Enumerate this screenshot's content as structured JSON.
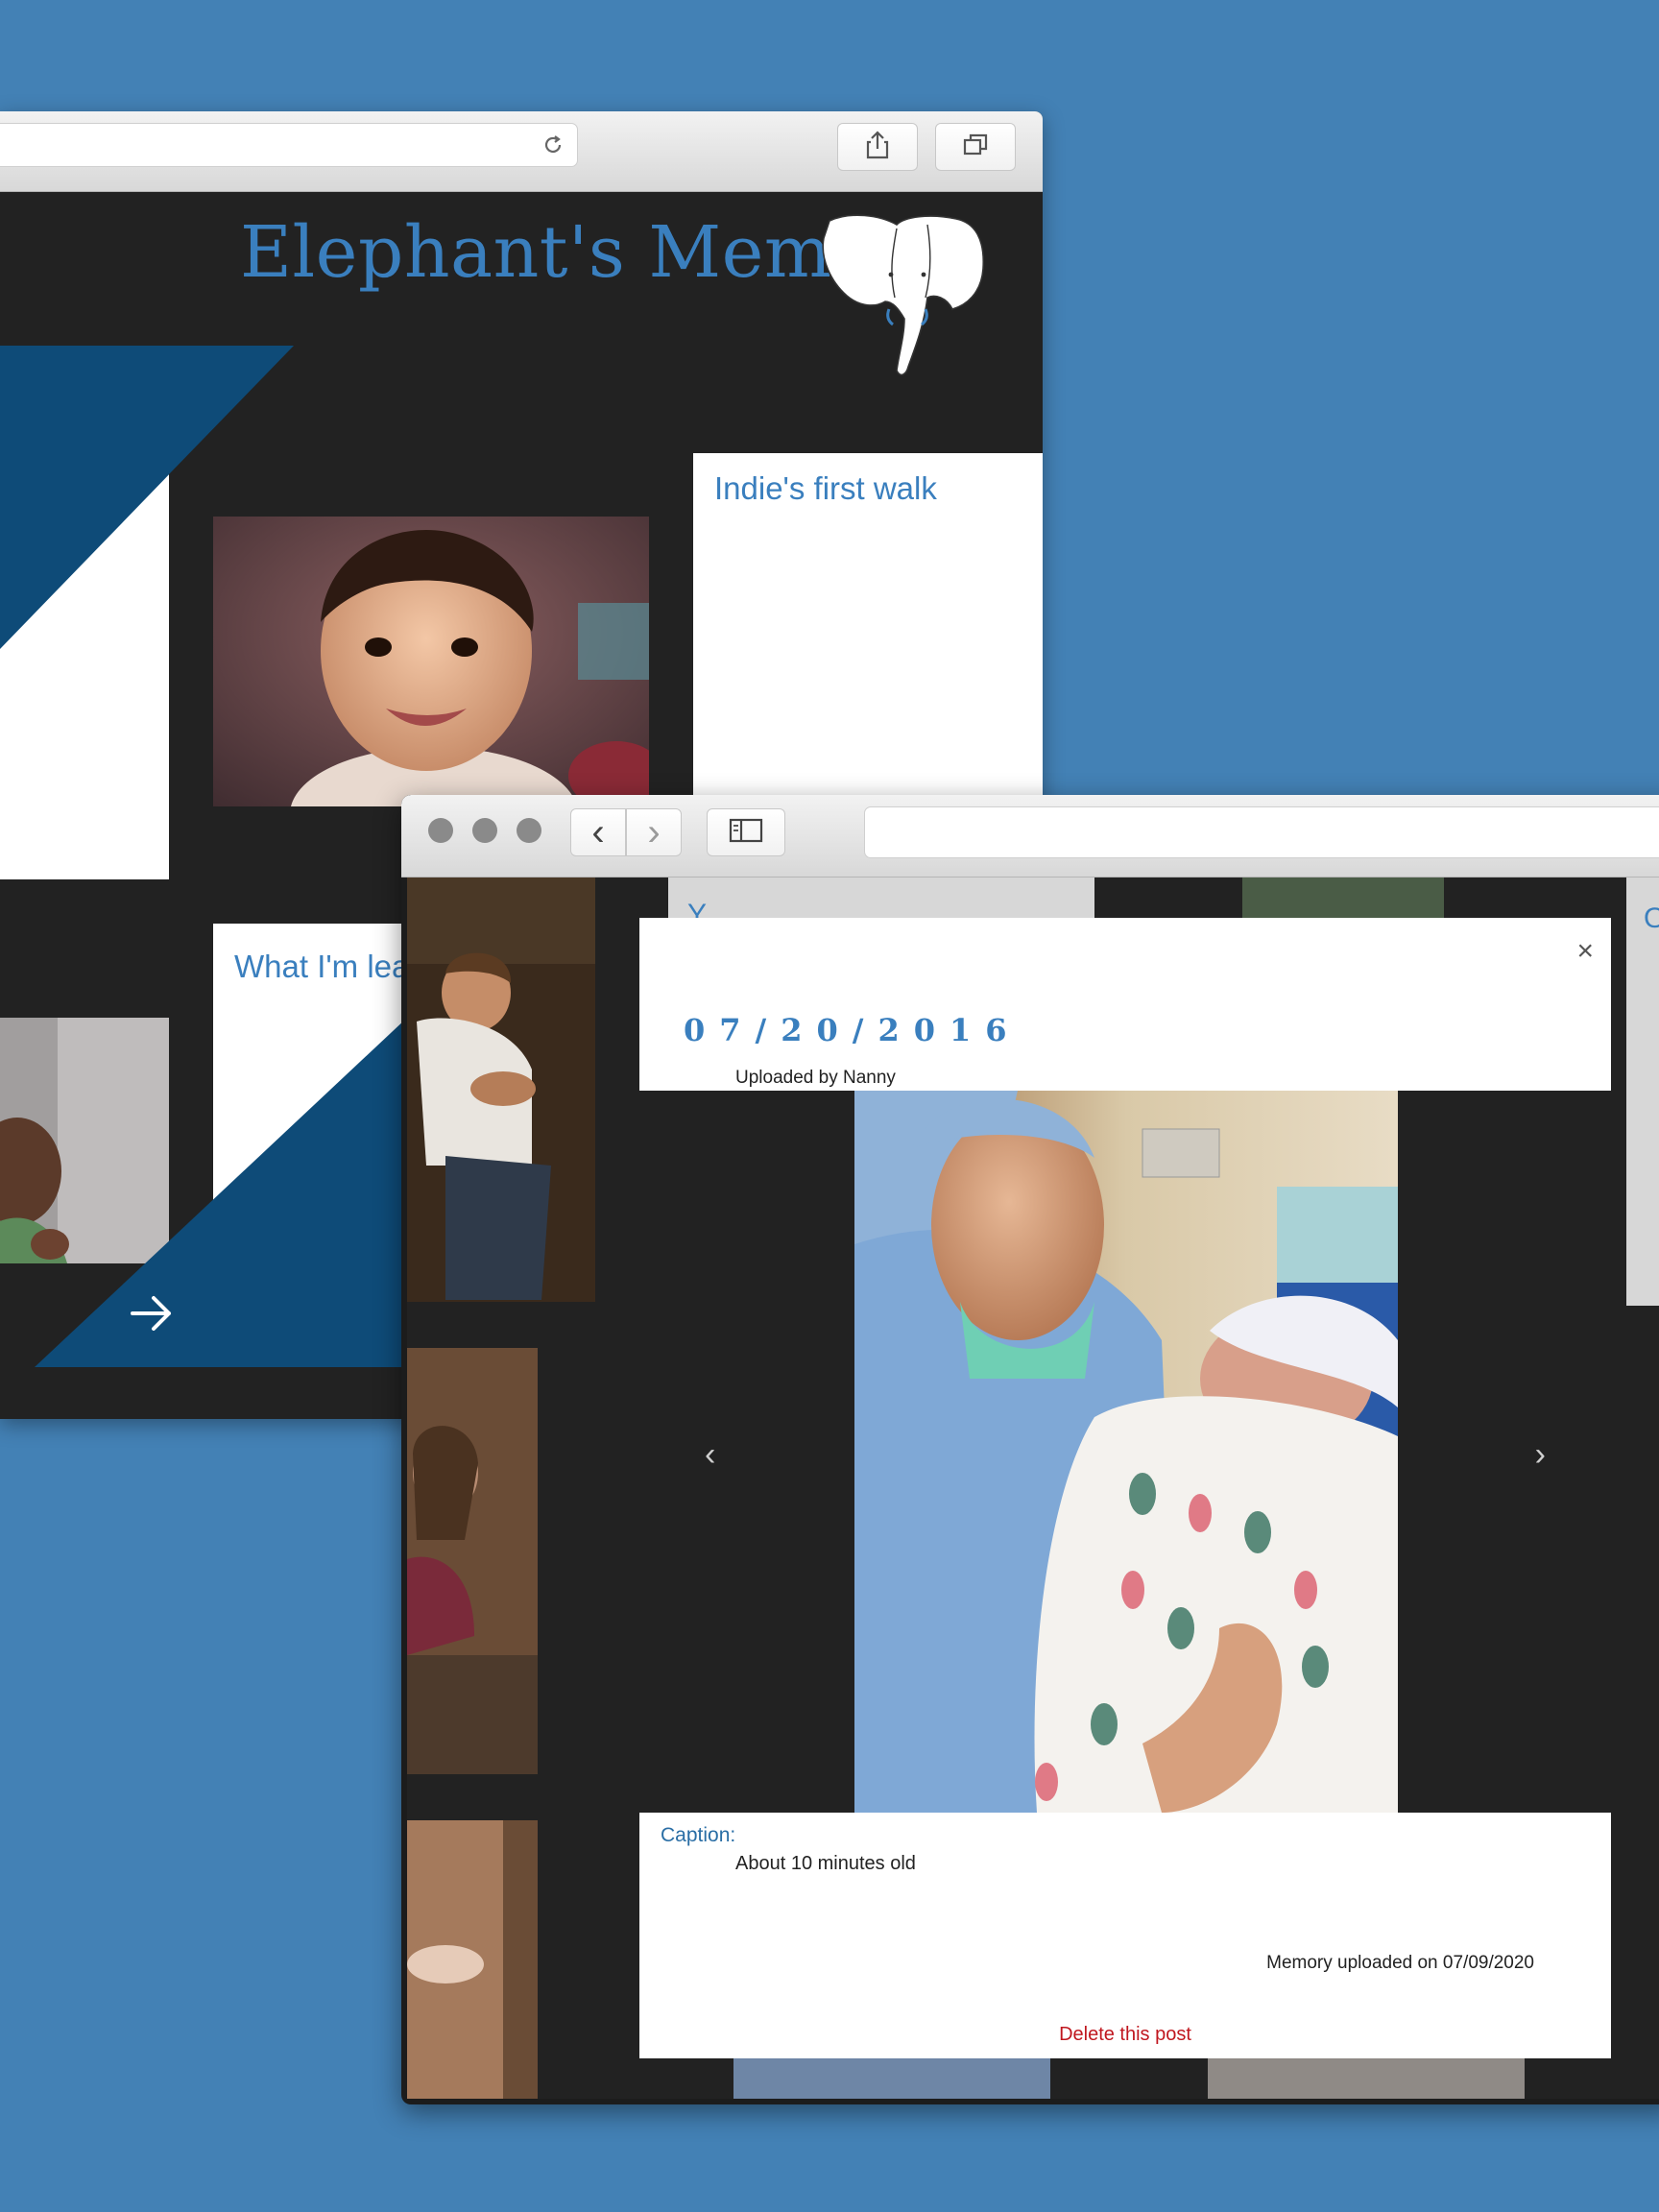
{
  "site": {
    "title": "Elephant's Memory"
  },
  "back_window": {
    "cards": [
      {
        "title": "Indie's first walk"
      },
      {
        "title": "What I'm lea"
      }
    ],
    "next_arrow": "→"
  },
  "front_window": {
    "partial_texts": [
      "Y",
      "O"
    ],
    "nav": {
      "back": "‹",
      "forward": "›"
    },
    "modal": {
      "close": "×",
      "date": "07/20/2016",
      "uploaded_by": "Uploaded by Nanny",
      "prev": "‹",
      "next": "›",
      "caption_label": "Caption:",
      "caption_text": "About 10 minutes old",
      "memory_uploaded": "Memory uploaded on 07/09/2020",
      "delete_label": "Delete this post"
    }
  },
  "colors": {
    "background": "#4381b5",
    "accent_blue": "#3a7fbe",
    "navy": "#0e4b78",
    "dark": "#242424",
    "delete_red": "#c0171f"
  },
  "icons": [
    "reload-icon",
    "share-icon",
    "tabs-icon",
    "sidebar-icon",
    "elephant-logo",
    "arrow-right-icon",
    "close-icon",
    "chevron-left-icon",
    "chevron-right-icon"
  ]
}
